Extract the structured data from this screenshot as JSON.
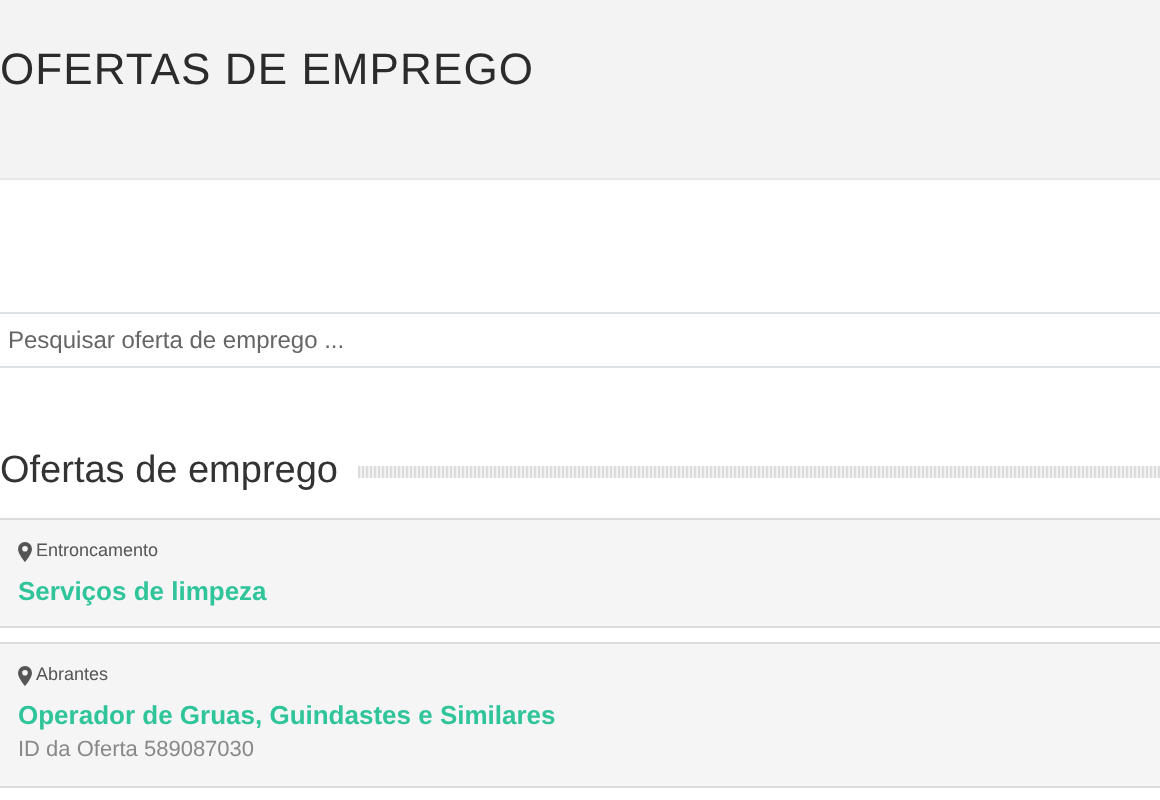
{
  "page_title": "OFERTAS DE EMPREGO",
  "search": {
    "placeholder": "Pesquisar oferta de emprego ..."
  },
  "section_title": "Ofertas de emprego",
  "jobs": [
    {
      "location": "Entroncamento",
      "title": "Serviços de limpeza"
    },
    {
      "location": "Abrantes",
      "title": "Operador de Gruas, Guindastes e Similares",
      "offer_id": "ID da Oferta 589087030"
    }
  ]
}
